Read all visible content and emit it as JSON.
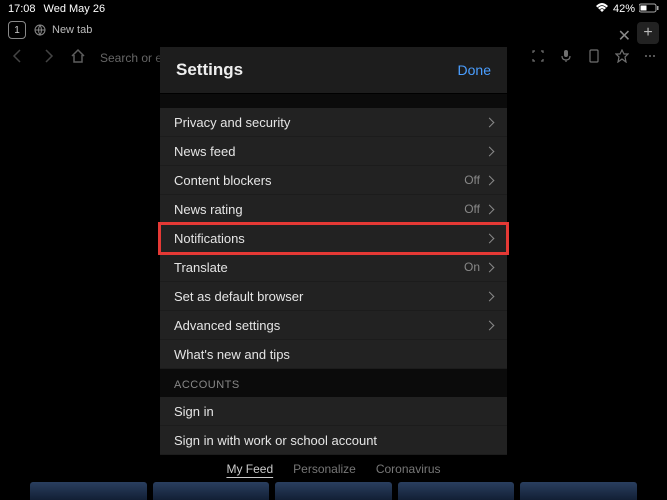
{
  "status": {
    "time": "17:08",
    "date": "Wed May 26",
    "battery": "42%"
  },
  "tabs": {
    "count": "1",
    "current": "New tab"
  },
  "toolbar": {
    "search_placeholder": "Search or en"
  },
  "settings": {
    "title": "Settings",
    "done": "Done",
    "rows": [
      {
        "label": "Privacy and security",
        "value": "",
        "highlighted": false,
        "chevron": true
      },
      {
        "label": "News feed",
        "value": "",
        "highlighted": false,
        "chevron": true
      },
      {
        "label": "Content blockers",
        "value": "Off",
        "highlighted": false,
        "chevron": true
      },
      {
        "label": "News rating",
        "value": "Off",
        "highlighted": false,
        "chevron": true
      },
      {
        "label": "Notifications",
        "value": "",
        "highlighted": true,
        "chevron": true
      },
      {
        "label": "Translate",
        "value": "On",
        "highlighted": false,
        "chevron": true
      },
      {
        "label": "Set as default browser",
        "value": "",
        "highlighted": false,
        "chevron": true
      },
      {
        "label": "Advanced settings",
        "value": "",
        "highlighted": false,
        "chevron": true
      },
      {
        "label": "What's new and tips",
        "value": "",
        "highlighted": false,
        "chevron": false
      }
    ],
    "accounts_header": "ACCOUNTS",
    "account_rows": [
      {
        "label": "Sign in"
      },
      {
        "label": "Sign in with work or school account"
      }
    ]
  },
  "feed": {
    "tabs": [
      "My Feed",
      "Personalize",
      "Coronavirus"
    ],
    "active": 0
  }
}
